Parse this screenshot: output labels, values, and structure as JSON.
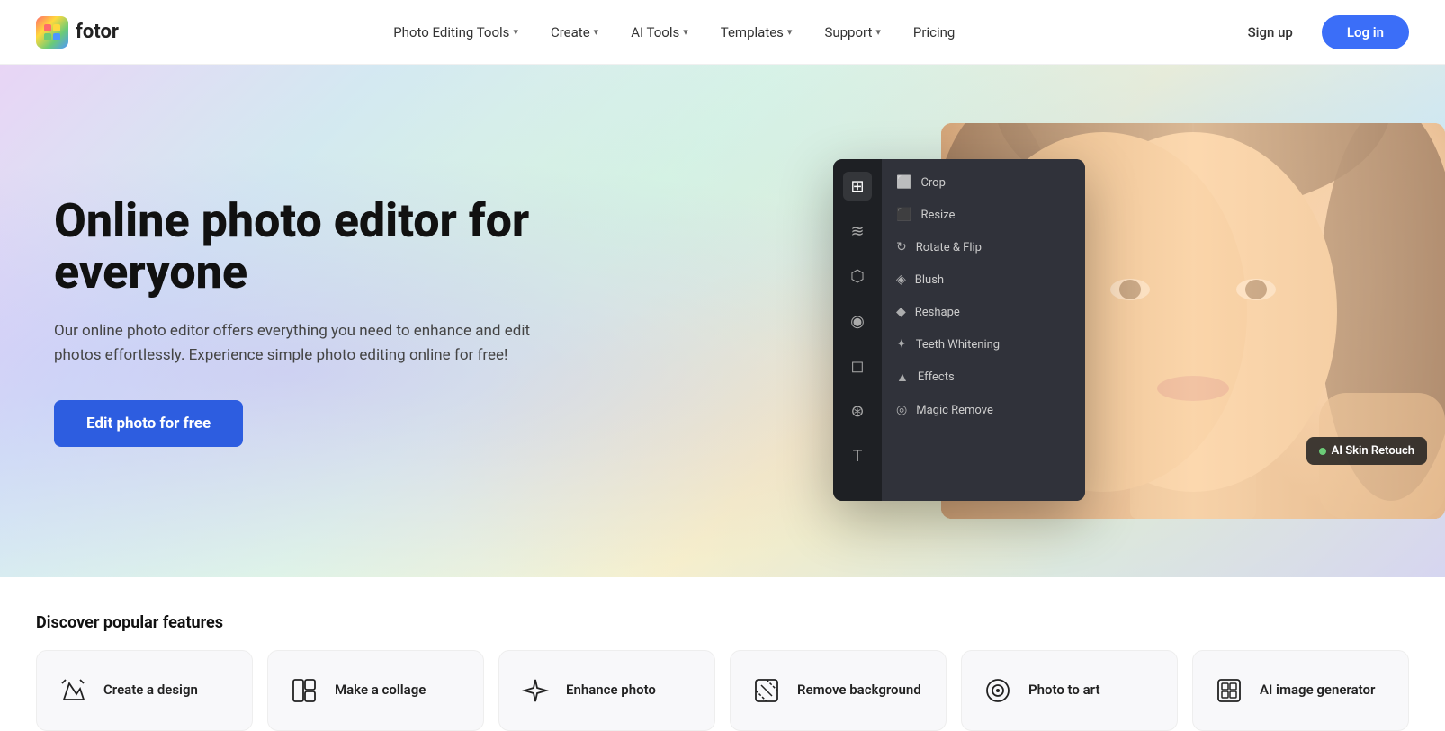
{
  "logo": {
    "text": "fotor"
  },
  "nav": {
    "links": [
      {
        "id": "photo-editing-tools",
        "label": "Photo Editing Tools",
        "hasDropdown": true
      },
      {
        "id": "create",
        "label": "Create",
        "hasDropdown": true
      },
      {
        "id": "ai-tools",
        "label": "AI Tools",
        "hasDropdown": true
      },
      {
        "id": "templates",
        "label": "Templates",
        "hasDropdown": true
      },
      {
        "id": "support",
        "label": "Support",
        "hasDropdown": true
      },
      {
        "id": "pricing",
        "label": "Pricing",
        "hasDropdown": false
      }
    ],
    "signup_label": "Sign up",
    "login_label": "Log in"
  },
  "hero": {
    "title": "Online photo editor for everyone",
    "subtitle": "Our online photo editor offers everything you need to enhance and edit photos effortlessly. Experience simple photo editing online for free!",
    "cta_label": "Edit photo for free"
  },
  "editor_panel": {
    "menu_items": [
      {
        "id": "crop",
        "label": "Crop",
        "icon": "⬜"
      },
      {
        "id": "resize",
        "label": "Resize",
        "icon": "⬛"
      },
      {
        "id": "rotate",
        "label": "Rotate & Flip",
        "icon": "🔄"
      },
      {
        "id": "blush",
        "label": "Blush",
        "icon": "💠"
      },
      {
        "id": "reshape",
        "label": "Reshape",
        "icon": "🔷"
      },
      {
        "id": "teeth",
        "label": "Teeth Whitening",
        "icon": "✨"
      },
      {
        "id": "effects",
        "label": "Effects",
        "icon": "🔺"
      },
      {
        "id": "magic",
        "label": "Magic Remove",
        "icon": "🔮"
      }
    ],
    "ai_badge_label": "AI Skin Retouch"
  },
  "discover": {
    "title": "Discover popular features",
    "cards": [
      {
        "id": "create-design",
        "label": "Create a design",
        "icon": "✂"
      },
      {
        "id": "make-collage",
        "label": "Make a collage",
        "icon": "⊞"
      },
      {
        "id": "enhance-photo",
        "label": "Enhance photo",
        "icon": "✦"
      },
      {
        "id": "remove-bg",
        "label": "Remove background",
        "icon": "⊡"
      },
      {
        "id": "photo-to-art",
        "label": "Photo to art",
        "icon": "◉"
      },
      {
        "id": "ai-image-gen",
        "label": "AI image generator",
        "icon": "⊟"
      }
    ]
  }
}
